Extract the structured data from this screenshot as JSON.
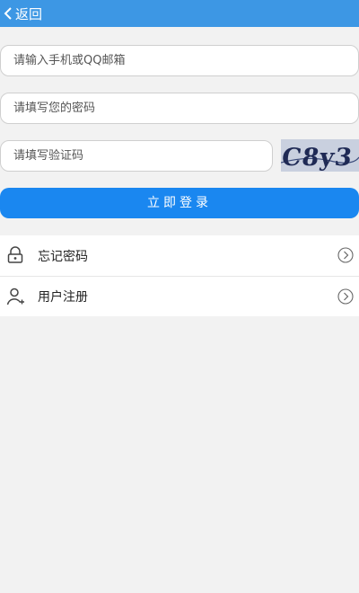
{
  "header": {
    "back_label": "返回",
    "accent_color": "#3d97e4"
  },
  "form": {
    "account_placeholder": "请输入手机或QQ邮箱",
    "password_placeholder": "请填写您的密码",
    "captcha_placeholder": "请填写验证码",
    "captcha_text": "C8y3",
    "login_label": "立即登录",
    "login_color": "#1a87f0"
  },
  "menu": {
    "items": [
      {
        "label": "忘记密码",
        "icon": "lock-icon"
      },
      {
        "label": "用户注册",
        "icon": "add-user-icon"
      }
    ]
  }
}
